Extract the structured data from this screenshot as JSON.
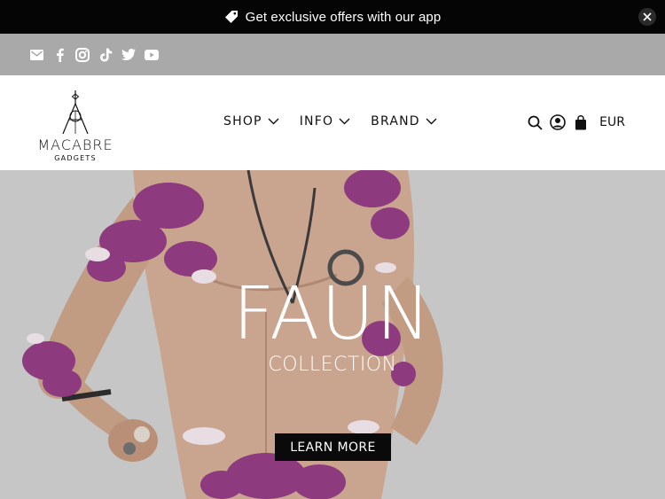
{
  "announcement": {
    "text": "Get exclusive offers with our app",
    "icon": "tag-icon",
    "close_icon": "close-icon"
  },
  "social": {
    "icons": [
      "email-icon",
      "facebook-icon",
      "instagram-icon",
      "tiktok-icon",
      "twitter-icon",
      "youtube-icon"
    ]
  },
  "header": {
    "logo": {
      "line1": "MACABRE",
      "line2": "GADGETS"
    },
    "nav": [
      {
        "label": "SHOP"
      },
      {
        "label": "INFO"
      },
      {
        "label": "BRAND"
      }
    ],
    "tools": {
      "icons": [
        "search-icon",
        "account-icon",
        "cart-icon"
      ],
      "currency": "EUR"
    }
  },
  "hero": {
    "title": "FAUN",
    "subtitle": "COLLECTION",
    "cta_label": "LEARN MORE"
  },
  "colors": {
    "announcement_bg": "#050505",
    "social_bg": "#a9a9a9",
    "hero_bg": "#c4c4c4",
    "cta_bg": "#0a0a0a",
    "orchid": "#8e3a7f"
  }
}
